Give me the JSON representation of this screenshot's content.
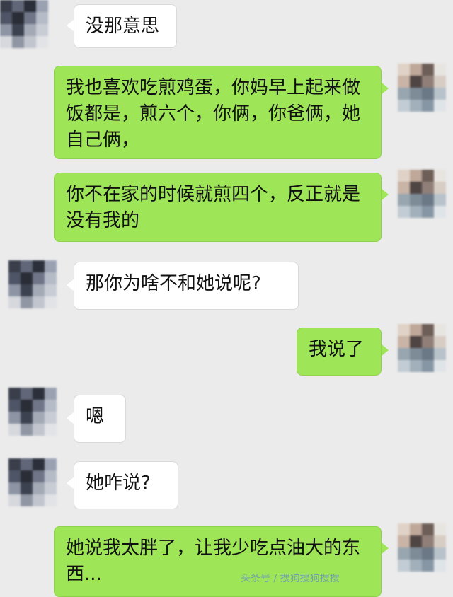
{
  "messages": [
    {
      "side": "left",
      "text": "没那意思"
    },
    {
      "side": "right",
      "text": "我也喜欢吃煎鸡蛋，你妈早上起来做饭都是，煎六个，你俩，你爸俩，她自己俩，"
    },
    {
      "side": "right",
      "text": "你不在家的时候就煎四个，反正就是没有我的"
    },
    {
      "side": "left",
      "text": "那你为啥不和她说呢?"
    },
    {
      "side": "right",
      "text": "我说了"
    },
    {
      "side": "left",
      "text": "嗯"
    },
    {
      "side": "left",
      "text": "她咋说?"
    },
    {
      "side": "right",
      "text": "她说我太胖了，让我少吃点油大的东西..."
    }
  ],
  "colors": {
    "background": "#ebebeb",
    "bubble_left": "#ffffff",
    "bubble_right": "#9ee558"
  },
  "icons": {
    "left_avatar": "pixelated-avatar",
    "right_avatar": "pixelated-avatar"
  },
  "watermark_text": "头条号 / 搜狗搜狗搜搜"
}
